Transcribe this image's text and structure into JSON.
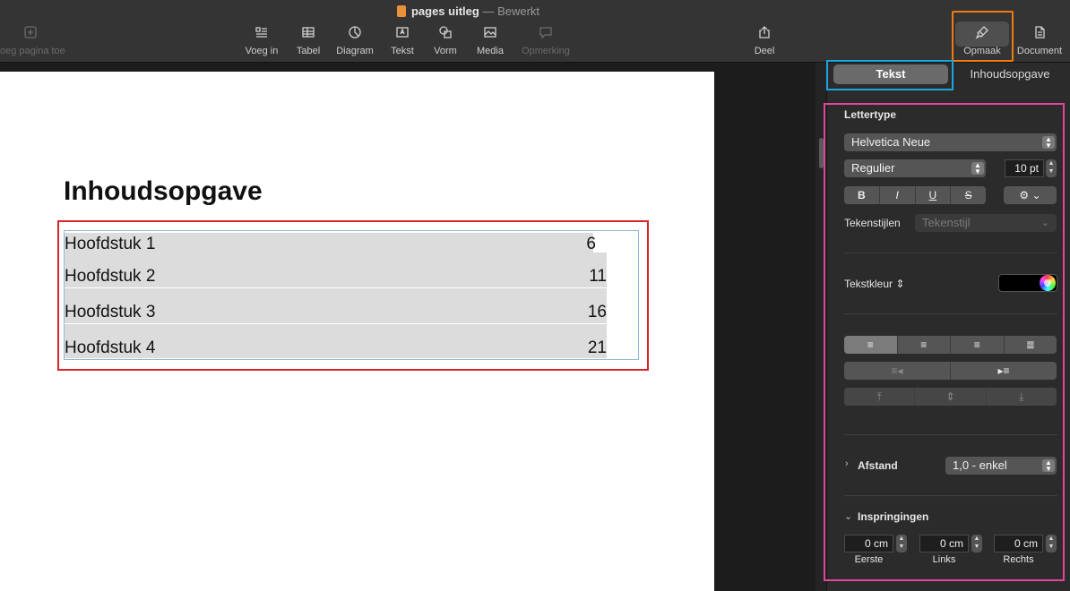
{
  "window": {
    "doc_name": "pages uitleg",
    "separator": "—",
    "doc_state": "Bewerkt"
  },
  "toolbar": {
    "add_page": "oeg pagina toe",
    "insert": "Voeg in",
    "table": "Tabel",
    "chart": "Diagram",
    "text": "Tekst",
    "shape": "Vorm",
    "media": "Media",
    "comment": "Opmerking",
    "share": "Deel",
    "format": "Opmaak",
    "document": "Document"
  },
  "document": {
    "heading": "Inhoudsopgave",
    "toc": [
      {
        "label": "Hoofdstuk 1",
        "page": "6"
      },
      {
        "label": "Hoofdstuk 2",
        "page": "11"
      },
      {
        "label": "Hoofdstuk 3",
        "page": "16"
      },
      {
        "label": "Hoofdstuk 4",
        "page": "21"
      }
    ]
  },
  "inspector": {
    "tabs": {
      "text": "Tekst",
      "toc": "Inhoudsopgave"
    },
    "font_section": "Lettertype",
    "font_family": "Helvetica Neue",
    "font_style": "Regulier",
    "font_size": "10 pt",
    "bold": "B",
    "italic": "I",
    "underline": "U",
    "strike": "S",
    "char_styles_label": "Tekenstijlen",
    "char_styles_value": "Tekenstijl",
    "text_color_label": "Tekstkleur",
    "text_color": "#000000",
    "spacing_label": "Afstand",
    "spacing_value": "1,0 - enkel",
    "indents_label": "Inspringingen",
    "indent_first": "0 cm",
    "indent_left": "0 cm",
    "indent_right": "0 cm",
    "indent_first_label": "Eerste",
    "indent_left_label": "Links",
    "indent_right_label": "Rechts"
  },
  "highlight_colors": {
    "format_button": "#f07b13",
    "text_tab": "#19a5e0",
    "inspector_panel": "#e0479b",
    "toc_table": "#d7262a"
  }
}
